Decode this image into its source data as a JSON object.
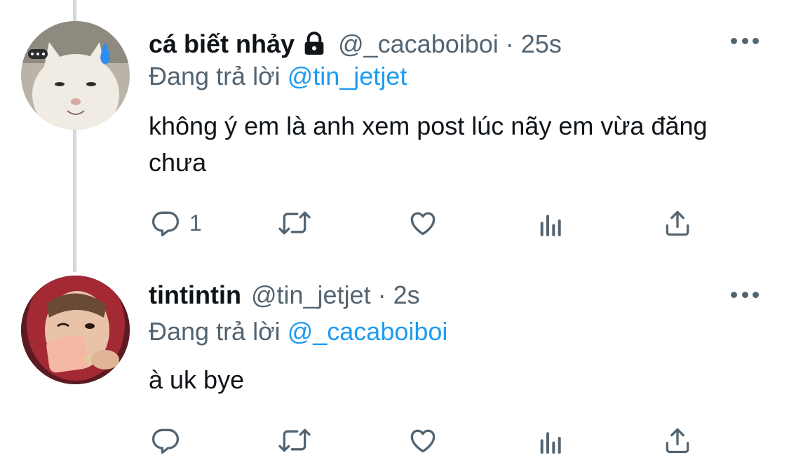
{
  "tweets": [
    {
      "name": "cá biết nhảy",
      "handle": "@_cacaboiboi",
      "separator": "·",
      "time": "25s",
      "reply_prefix": "Đang trả lời",
      "reply_mention": "@tin_jetjet",
      "text": "không ý em là anh xem post lúc nãy em vừa đăng chưa",
      "reply_count": "1",
      "protected": true,
      "avatar": "cat-avatar"
    },
    {
      "name": "tintintin",
      "handle": "@tin_jetjet",
      "separator": "·",
      "time": "2s",
      "reply_prefix": "Đang trả lời",
      "reply_mention": "@_cacaboiboi",
      "text": "à uk bye",
      "reply_count": "",
      "protected": false,
      "avatar": "person-avatar"
    }
  ],
  "icons": [
    "lock-icon",
    "more-icon",
    "reply-icon",
    "retweet-icon",
    "like-icon",
    "views-icon",
    "share-icon"
  ],
  "colors": {
    "text": "#0f1419",
    "secondary": "#536471",
    "link": "#1d9bf0",
    "thread_line": "#cfd9de"
  }
}
